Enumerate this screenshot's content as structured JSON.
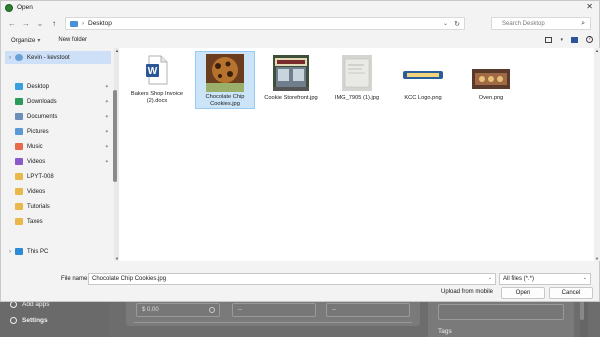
{
  "dialog": {
    "title": "Open",
    "close_icon": "✕"
  },
  "nav": {
    "path": "Desktop",
    "search_placeholder": "Search Desktop"
  },
  "commandbar": {
    "organize": "Organize",
    "new_folder": "New folder"
  },
  "sidebar": {
    "items": [
      {
        "label": "Kevin - kevstoot",
        "icon": "user-icon",
        "pinned": false,
        "chevron": true
      },
      {
        "label": "Desktop",
        "icon": "desktop-icon",
        "pinned": true
      },
      {
        "label": "Downloads",
        "icon": "downloads-icon",
        "pinned": true
      },
      {
        "label": "Documents",
        "icon": "documents-icon",
        "pinned": true
      },
      {
        "label": "Pictures",
        "icon": "pictures-icon",
        "pinned": true
      },
      {
        "label": "Music",
        "icon": "music-icon",
        "pinned": true
      },
      {
        "label": "Videos",
        "icon": "videos-icon",
        "pinned": true
      },
      {
        "label": "LPYT-008",
        "icon": "folder-icon",
        "pinned": false
      },
      {
        "label": "Videos",
        "icon": "folder-icon",
        "pinned": false
      },
      {
        "label": "Tutorials",
        "icon": "folder-icon",
        "pinned": false
      },
      {
        "label": "Taxes",
        "icon": "folder-icon",
        "pinned": false
      },
      {
        "label": "This PC",
        "icon": "this-pc-icon",
        "pinned": false,
        "chevron": true
      }
    ]
  },
  "files": [
    {
      "name": "Bakers Shop Invoice (2).docx",
      "type": "word-document"
    },
    {
      "name": "Chocolate Chip Cookies.jpg",
      "type": "image",
      "selected": true
    },
    {
      "name": "Cookie Storefront.jpg",
      "type": "image"
    },
    {
      "name": "IMG_7905 (1).jpg",
      "type": "image"
    },
    {
      "name": "KCC Logo.png",
      "type": "image"
    },
    {
      "name": "Oven.png",
      "type": "image"
    }
  ],
  "bottom": {
    "file_name_label": "File name:",
    "file_name_value": "Chocolate Chip Cookies.jpg",
    "filter_value": "All files (*.*)",
    "upload_label": "Upload from mobile",
    "open_label": "Open",
    "cancel_label": "Cancel"
  },
  "background_app": {
    "add_apps": "Add apps",
    "settings": "Settings",
    "amount": "$ 0.00",
    "dash1": "--",
    "dash2": "--",
    "tags": "Tags"
  },
  "colors": {
    "accent": "#0067c0",
    "selection": "#cce4f7"
  }
}
